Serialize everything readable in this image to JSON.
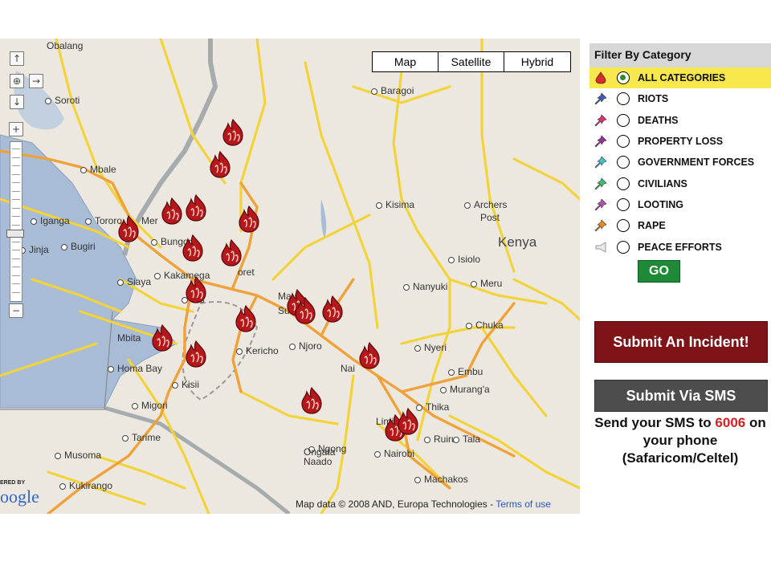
{
  "map": {
    "map_types": [
      "Map",
      "Satellite",
      "Hybrid"
    ],
    "powered_by": "ERED BY",
    "logo": "oogle",
    "attribution": "Map data © 2008 AND, Europa Technologies - ",
    "terms_link": "Terms of use",
    "controls": {
      "up": "↑",
      "left": "←",
      "center": "⊕",
      "right": "→",
      "down": "↓",
      "zoom_in": "+",
      "zoom_out": "−"
    },
    "country_label": "Kenya",
    "places": [
      "Obalang",
      "Soroti",
      "Mbale",
      "Iganga",
      "Tororo",
      "Mer",
      "Bugiri",
      "Jinja",
      "Bungom",
      "oret",
      "Kakamega",
      "Kis",
      "Siaya",
      "Mbita",
      "Homa Bay",
      "Kisii",
      "Migori",
      "Tarime",
      "Musoma",
      "Kukirango",
      "Kericho",
      "Mau",
      "Sum",
      "Njoro",
      "Nai",
      "Limi",
      "Nairobi",
      "Ngong",
      "Ongata",
      "Naado",
      "Machakos",
      "Thika",
      "Ruiru",
      "Tala",
      "Murang'a",
      "Embu",
      "Chuka",
      "Nyeri",
      "Nanyuki",
      "Meru",
      "Isiolo",
      "Archers",
      "Post",
      "Kisima",
      "Baragoi"
    ],
    "marker_icon": "fire-icon",
    "marker_color": "#b5171b"
  },
  "sidebar": {
    "filter_title": "Filter By Category",
    "categories": [
      {
        "label": "ALL CATEGORIES",
        "icon": "droplet-icon",
        "color": "#d1302b",
        "selected": true
      },
      {
        "label": "RIOTS",
        "icon": "pushpin-icon",
        "color": "#3b5bbd",
        "selected": false
      },
      {
        "label": "DEATHS",
        "icon": "pushpin-icon",
        "color": "#e0307a",
        "selected": false
      },
      {
        "label": "PROPERTY LOSS",
        "icon": "pushpin-icon",
        "color": "#9a2f9e",
        "selected": false
      },
      {
        "label": "GOVERNMENT FORCES",
        "icon": "pushpin-icon",
        "color": "#3fc3d0",
        "selected": false
      },
      {
        "label": "CIVILIANS",
        "icon": "pushpin-icon",
        "color": "#3fbf6e",
        "selected": false
      },
      {
        "label": "LOOTING",
        "icon": "pushpin-icon",
        "color": "#b94fb5",
        "selected": false
      },
      {
        "label": "RAPE",
        "icon": "pushpin-icon",
        "color": "#f08a24",
        "selected": false
      },
      {
        "label": "PEACE EFFORTS",
        "icon": "megaphone-icon",
        "color": "#999999",
        "selected": false
      }
    ],
    "go_label": "GO",
    "submit_incident": "Submit An Incident!",
    "submit_sms": "Submit Via SMS",
    "sms_line1_pre": "Send your SMS to ",
    "sms_number": "6006",
    "sms_line1_post": " on",
    "sms_line2": "your phone",
    "sms_line3": "(Safaricom/Celtel)"
  }
}
